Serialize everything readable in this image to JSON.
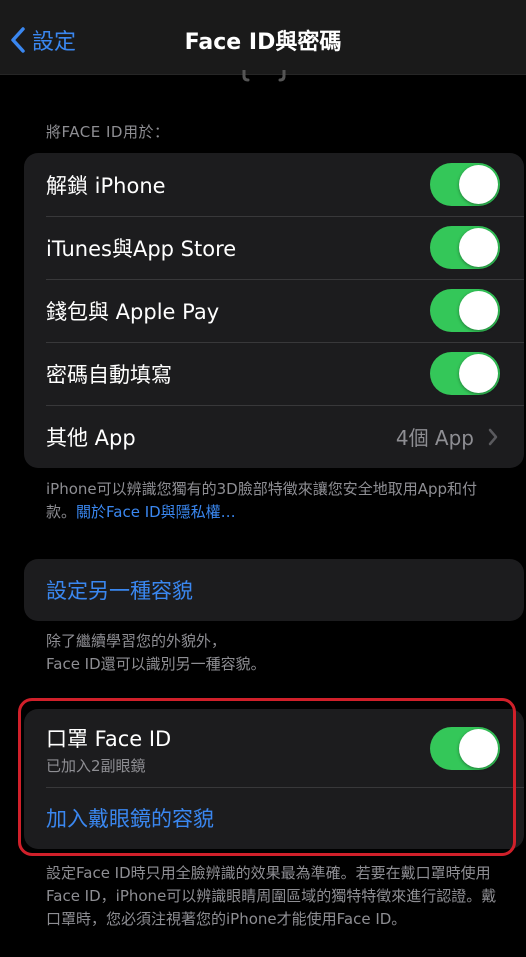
{
  "nav": {
    "back_label": "設定",
    "title": "Face ID與密碼"
  },
  "use_for": {
    "header": "將FACE ID用於：",
    "items": [
      {
        "label": "解鎖 iPhone",
        "toggle": true
      },
      {
        "label": "iTunes與App Store",
        "toggle": true
      },
      {
        "label": "錢包與 Apple Pay",
        "toggle": true
      },
      {
        "label": "密碼自動填寫",
        "toggle": true
      }
    ],
    "other_apps": {
      "label": "其他 App",
      "value": "4個 App"
    },
    "footer_text": "iPhone可以辨識您獨有的3D臉部特徵來讓您安全地取用App和付款。",
    "footer_link": "關於Face ID與隱私權…"
  },
  "alternate": {
    "button_label": "設定另一種容貌",
    "footer_line1": "除了繼續學習您的外貌外，",
    "footer_line2": "Face ID還可以識別另一種容貌。"
  },
  "mask": {
    "title": "口罩 Face ID",
    "subtitle": "已加入2副眼鏡",
    "toggle": true,
    "add_glasses_label": "加入戴眼鏡的容貌",
    "footer": "設定Face ID時只用全臉辨識的效果最為準確。若要在戴口罩時使用Face ID，iPhone可以辨識眼睛周圍區域的獨特特徵來進行認證。戴口罩時，您必須注視著您的iPhone才能使用Face ID。"
  },
  "colors": {
    "accent": "#3a87f0",
    "toggle_on": "#34c759",
    "highlight": "#d0202a"
  }
}
